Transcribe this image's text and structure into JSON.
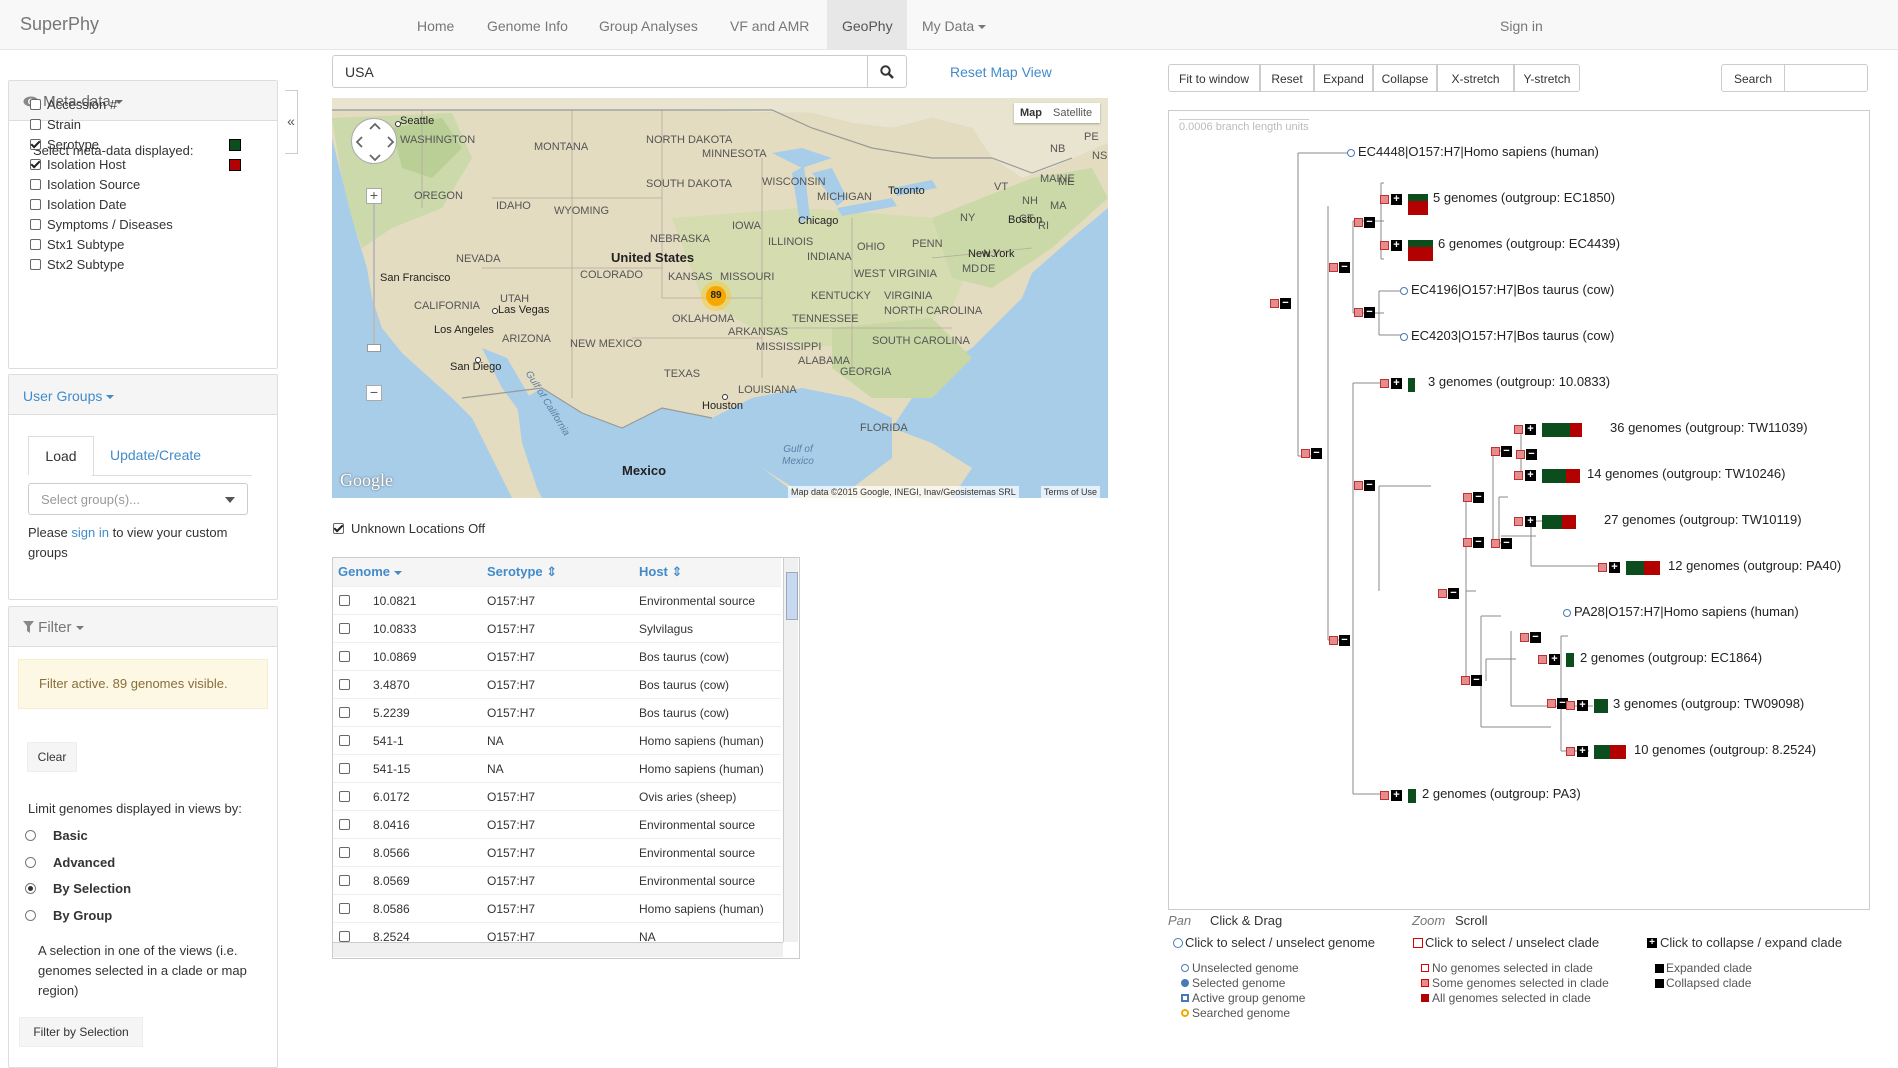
{
  "navbar": {
    "brand": "SuperPhy",
    "items": [
      "Home",
      "Genome Info",
      "Group Analyses",
      "VF and AMR",
      "GeoPhy",
      "My Data"
    ],
    "signin": "Sign in"
  },
  "metadata": {
    "title": "Meta-data",
    "subtitle": "Select meta-data displayed:",
    "items": [
      {
        "label": "Accession #",
        "checked": false
      },
      {
        "label": "Strain",
        "checked": false
      },
      {
        "label": "Serotype",
        "checked": true,
        "color": "#0b4d1c"
      },
      {
        "label": "Isolation Host",
        "checked": true,
        "color": "#b30000"
      },
      {
        "label": "Isolation Source",
        "checked": false
      },
      {
        "label": "Isolation Date",
        "checked": false
      },
      {
        "label": "Symptoms / Diseases",
        "checked": false
      },
      {
        "label": "Stx1 Subtype",
        "checked": false
      },
      {
        "label": "Stx2 Subtype",
        "checked": false
      }
    ]
  },
  "groups": {
    "title": "User Groups",
    "tab_load": "Load",
    "tab_update": "Update/Create",
    "select_placeholder": "Select group(s)...",
    "note_before": "Please",
    "note_link": "sign in",
    "note_after": "to view your custom",
    "note_line2": "groups"
  },
  "filter": {
    "title": "Filter",
    "status": "Filter active. 89 genomes visible.",
    "clear": "Clear",
    "limit_label": "Limit genomes displayed in views by:",
    "options": [
      {
        "label": "Basic",
        "selected": false
      },
      {
        "label": "Advanced",
        "selected": false
      },
      {
        "label": "By Selection",
        "selected": true
      },
      {
        "label": "By Group",
        "selected": false
      }
    ],
    "desc_lines": [
      "A selection in one of the views (i.e.",
      "genomes selected in a clade or map",
      "region)"
    ],
    "filter_btn": "Filter by Selection"
  },
  "search": {
    "value": "USA",
    "reset": "Reset Map View"
  },
  "map": {
    "type_map": "Map",
    "type_satellite": "Satellite",
    "cluster_count": "89",
    "attribution": "Map data ©2015 Google, INEGI, Inav/Geosistemas SRL",
    "terms": "Terms of Use",
    "google": "Google",
    "country_labels": [
      "United States",
      "Mexico"
    ],
    "state_labels": [
      "WASHINGTON",
      "MONTANA",
      "NORTH DAKOTA",
      "MINNESOTA",
      "OREGON",
      "IDAHO",
      "SOUTH DAKOTA",
      "WISCONSIN",
      "MICHIGAN",
      "WYOMING",
      "IOWA",
      "NEVADA",
      "NEBRASKA",
      "ILLINOIS",
      "INDIANA",
      "OHIO",
      "PENN",
      "NY",
      "VT",
      "NH",
      "ME",
      "MAINE",
      "UTAH",
      "COLORADO",
      "KANSAS",
      "MISSOURI",
      "KENTUCKY",
      "VIRGINIA",
      "WEST VIRGINIA",
      "CALIFORNIA",
      "ARIZONA",
      "NEW MEXICO",
      "OKLAHOMA",
      "ARKANSAS",
      "TENNESSEE",
      "NORTH CAROLINA",
      "SOUTH CAROLINA",
      "MISSISSIPPI",
      "ALABAMA",
      "GEORGIA",
      "TEXAS",
      "LOUISIANA",
      "FLORIDA",
      "MA",
      "CT",
      "RI",
      "NJ",
      "DE",
      "MD",
      "NB",
      "PE",
      "NS"
    ],
    "city_labels": [
      "Seattle",
      "Chicago",
      "Toronto",
      "Boston",
      "New York",
      "San Francisco",
      "Las Vegas",
      "Los Angeles",
      "San Diego",
      "Houston"
    ],
    "water_labels": [
      "Gulf of California",
      "Gulf of Mexico"
    ]
  },
  "unknown_toggle": "Unknown Locations Off",
  "table": {
    "headers": [
      "Genome",
      "Serotype",
      "Host"
    ],
    "rows": [
      [
        "10.0821",
        "O157:H7",
        "Environmental source"
      ],
      [
        "10.0833",
        "O157:H7",
        "Sylvilagus"
      ],
      [
        "10.0869",
        "O157:H7",
        "Bos taurus (cow)"
      ],
      [
        "3.4870",
        "O157:H7",
        "Bos taurus (cow)"
      ],
      [
        "5.2239",
        "O157:H7",
        "Bos taurus (cow)"
      ],
      [
        "541-1",
        "NA",
        "Homo sapiens (human)"
      ],
      [
        "541-15",
        "NA",
        "Homo sapiens (human)"
      ],
      [
        "6.0172",
        "O157:H7",
        "Ovis aries (sheep)"
      ],
      [
        "8.0416",
        "O157:H7",
        "Environmental source"
      ],
      [
        "8.0566",
        "O157:H7",
        "Environmental source"
      ],
      [
        "8.0569",
        "O157:H7",
        "Environmental source"
      ],
      [
        "8.0586",
        "O157:H7",
        "Homo sapiens (human)"
      ],
      [
        "8.2524",
        "O157:H7",
        "NA"
      ]
    ]
  },
  "tree": {
    "toolbar": [
      "Fit to window",
      "Reset",
      "Expand",
      "Collapse",
      "X-stretch",
      "Y-stretch"
    ],
    "search_btn": "Search",
    "scale": "0.0006 branch length units",
    "labels": [
      "EC4448|O157:H7|Homo sapiens (human)",
      "5 genomes (outgroup: EC1850)",
      "6 genomes (outgroup: EC4439)",
      "EC4196|O157:H7|Bos taurus (cow)",
      "EC4203|O157:H7|Bos taurus (cow)",
      "3 genomes (outgroup: 10.0833)",
      "36 genomes (outgroup: TW11039)",
      "14 genomes (outgroup: TW10246)",
      "27 genomes (outgroup: TW10119)",
      "12 genomes (outgroup: PA40)",
      "PA28|O157:H7|Homo sapiens (human)",
      "2 genomes (outgroup: EC1864)",
      "3 genomes (outgroup: TW09098)",
      "10 genomes (outgroup: 8.2524)",
      "2 genomes (outgroup: PA3)"
    ],
    "pan_label": "Pan",
    "pan_value": "Click & Drag",
    "zoom_label": "Zoom",
    "zoom_value": "Scroll",
    "legend_main": [
      "Click to select / unselect genome",
      "Click to select / unselect clade",
      "Click to collapse / expand clade"
    ],
    "legend_genome": [
      "Unselected genome",
      "Selected genome",
      "Active group genome",
      "Searched genome"
    ],
    "legend_clade": [
      "No genomes selected in clade",
      "Some genomes selected in clade",
      "All genomes selected in clade"
    ],
    "legend_expand": [
      "Expanded clade",
      "Collapsed clade"
    ]
  }
}
